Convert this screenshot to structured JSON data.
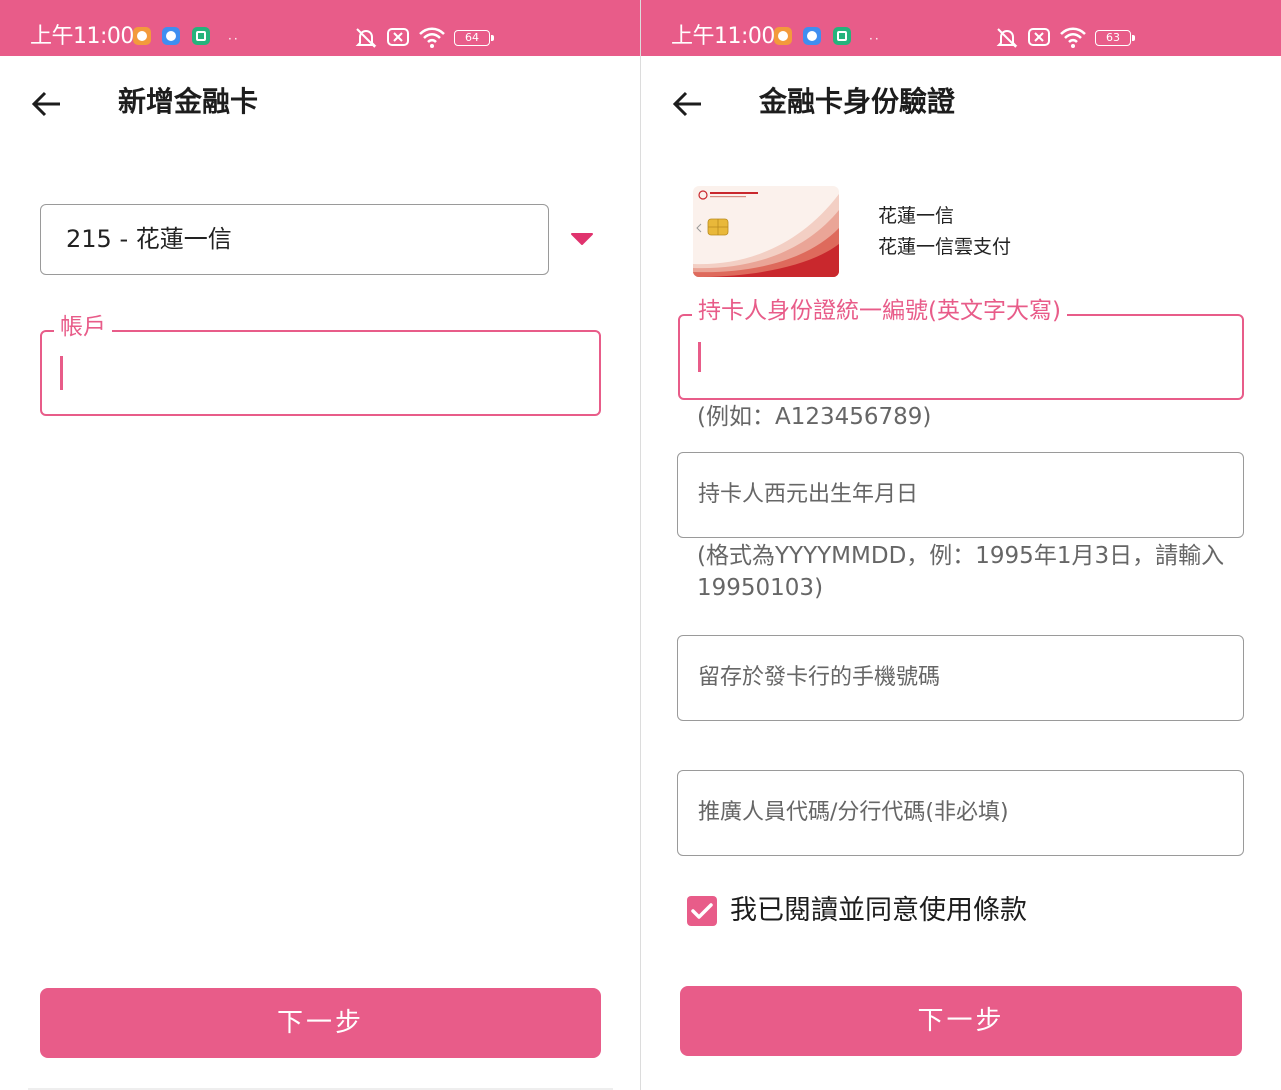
{
  "colors": {
    "accent": "#e85c89",
    "border": "#9a9a9a",
    "text": "#1d1d1d",
    "hint": "#666666"
  },
  "left_screen": {
    "status_bar": {
      "time": "上午11:00",
      "battery": "64",
      "icons": [
        "orange-app-icon",
        "blue-app-icon",
        "green-app-icon",
        "more-dots-icon",
        "mute-bell-icon",
        "no-sim-icon",
        "wifi-icon",
        "battery-icon"
      ]
    },
    "header": {
      "title": "新增金融卡",
      "back_icon": "back-arrow-icon"
    },
    "bank_select": {
      "value": "215 - 花蓮一信",
      "icon": "dropdown-triangle-icon"
    },
    "account_field": {
      "label": "帳戶",
      "value": ""
    },
    "next_button": "下一步"
  },
  "right_screen": {
    "status_bar": {
      "time": "上午11:00",
      "battery": "63",
      "icons": [
        "orange-app-icon",
        "blue-app-icon",
        "green-app-icon",
        "more-dots-icon",
        "mute-bell-icon",
        "no-sim-icon",
        "wifi-icon",
        "battery-icon"
      ]
    },
    "header": {
      "title": "金融卡身份驗證",
      "back_icon": "back-arrow-icon"
    },
    "card": {
      "bank_name": "花蓮一信",
      "card_name": "花蓮一信雲支付"
    },
    "id_field": {
      "label": "持卡人身份證統一編號(英文字大寫)",
      "value": "",
      "hint": "(例如：A123456789)"
    },
    "birth_field": {
      "placeholder": "持卡人西元出生年月日",
      "hint": "(格式為YYYYMMDD，例：1995年1月3日，請輸入19950103)"
    },
    "phone_field": {
      "placeholder": "留存於發卡行的手機號碼"
    },
    "referral_field": {
      "placeholder": "推廣人員代碼/分行代碼(非必填)"
    },
    "terms": {
      "checked": true,
      "label": "我已閱讀並同意使用條款"
    },
    "next_button": "下一步"
  }
}
